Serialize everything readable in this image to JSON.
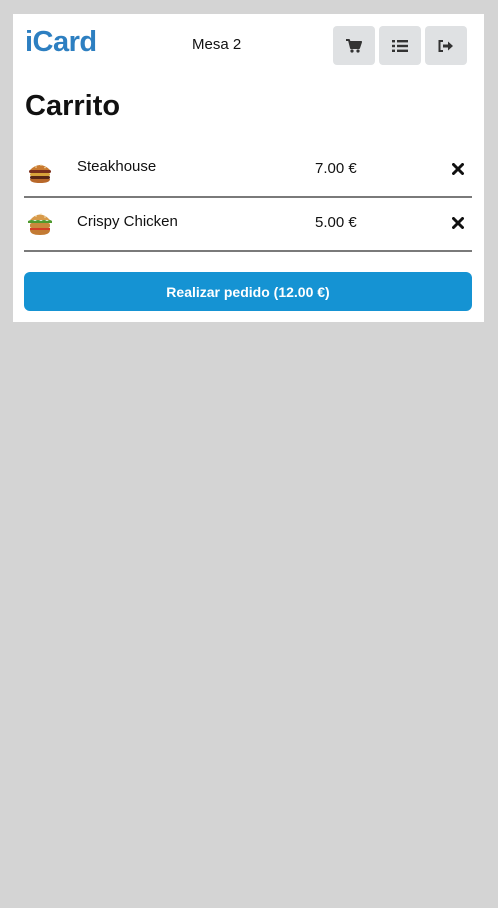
{
  "header": {
    "brand": "iCard",
    "table": "Mesa 2",
    "buttons": [
      {
        "icon": "cart-icon"
      },
      {
        "icon": "list-icon"
      },
      {
        "icon": "logout-icon"
      }
    ]
  },
  "page": {
    "title": "Carrito"
  },
  "cart": {
    "items": [
      {
        "name": "Steakhouse",
        "price": "7.00 €",
        "icon": "burger-icon"
      },
      {
        "name": "Crispy Chicken",
        "price": "5.00 €",
        "icon": "burger-icon"
      }
    ],
    "order_button": "Realizar pedido (12.00 €)"
  },
  "colors": {
    "brand": "#2d7fc1",
    "primary_button": "#1593d3",
    "background": "#d4d4d4",
    "header_button": "#dfe1e3"
  }
}
